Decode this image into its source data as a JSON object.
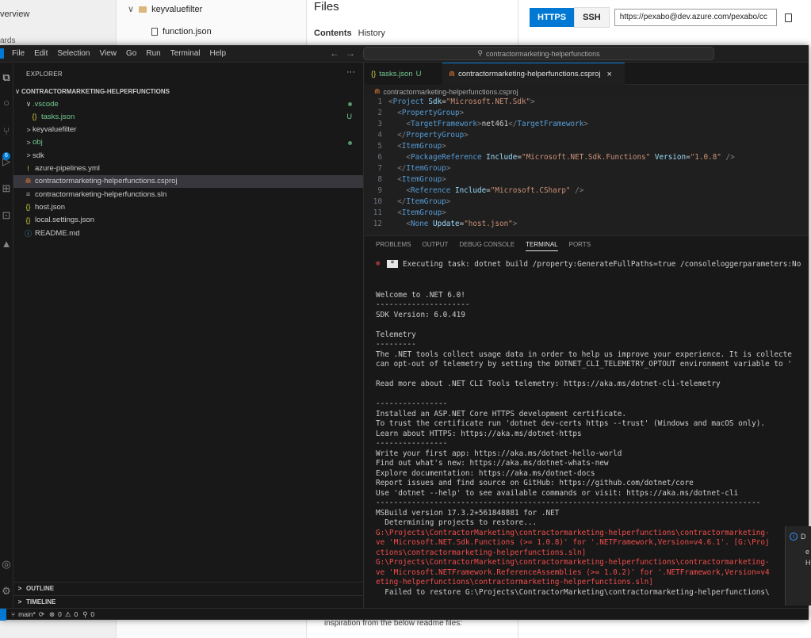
{
  "browser": {
    "left_nav": {
      "overview": "verview",
      "boards": "ards"
    },
    "tree": [
      {
        "label": "keyvaluefilter",
        "icon": "folder-icon"
      },
      {
        "label": "function.json",
        "icon": "file-icon"
      }
    ],
    "files_title": "Files",
    "tabs": [
      "Contents",
      "History"
    ],
    "bottom_text": "inspiration from the below readme files:",
    "clone": {
      "https": "HTTPS",
      "ssh": "SSH",
      "url": "https://pexabo@dev.azure.com/pexabo/cc"
    }
  },
  "vscode": {
    "menu": [
      "File",
      "Edit",
      "Selection",
      "View",
      "Go",
      "Run",
      "Terminal",
      "Help"
    ],
    "command_center": "contractormarketing-helperfunctions",
    "explorer": {
      "header": "EXPLORER",
      "root": "CONTRACTORMARKETING-HELPERFUNCTIONS",
      "items": [
        {
          "label": ".vscode",
          "chev": "∨",
          "icon": "",
          "status": "dot",
          "color": "green"
        },
        {
          "label": "tasks.json",
          "chev": "",
          "icon": "{}",
          "status": "U",
          "color": "green"
        },
        {
          "label": "keyvaluefilter",
          "chev": ">",
          "icon": "",
          "status": "",
          "color": ""
        },
        {
          "label": "obj",
          "chev": ">",
          "icon": "",
          "status": "dot",
          "color": "green"
        },
        {
          "label": "sdk",
          "chev": ">",
          "icon": "",
          "status": "",
          "color": ""
        },
        {
          "label": "azure-pipelines.yml",
          "chev": "",
          "icon": "!",
          "status": "",
          "color": ""
        },
        {
          "label": "contractormarketing-helperfunctions.csproj",
          "chev": "",
          "icon": "⋒",
          "status": "",
          "color": ""
        },
        {
          "label": "contractormarketing-helperfunctions.sln",
          "chev": "",
          "icon": "≡",
          "status": "",
          "color": ""
        },
        {
          "label": "host.json",
          "chev": "",
          "icon": "{}",
          "status": "",
          "color": ""
        },
        {
          "label": "local.settings.json",
          "chev": "",
          "icon": "{}",
          "status": "",
          "color": ""
        },
        {
          "label": "README.md",
          "chev": "",
          "icon": "ⓘ",
          "status": "",
          "color": ""
        }
      ],
      "outline": "OUTLINE",
      "timeline": "TIMELINE"
    },
    "tabs": [
      {
        "label": "tasks.json",
        "badge": "U"
      },
      {
        "label": "contractormarketing-helperfunctions.csproj",
        "close": "×"
      }
    ],
    "breadcrumb": "contractormarketing-helperfunctions.csproj",
    "code_lines": [
      {
        "n": "1",
        "html": "<span class='tg'>&lt;</span><span class='tn'>Project</span> <span class='at'>Sdk</span>=<span class='av'>\"Microsoft.NET.Sdk\"</span><span class='tg'>&gt;</span>"
      },
      {
        "n": "2",
        "html": "  <span class='tg'>&lt;</span><span class='tn'>PropertyGroup</span><span class='tg'>&gt;</span>"
      },
      {
        "n": "3",
        "html": "    <span class='tg'>&lt;</span><span class='tn'>TargetFramework</span><span class='tg'>&gt;</span>net461<span class='tg'>&lt;/</span><span class='tn'>TargetFramework</span><span class='tg'>&gt;</span>"
      },
      {
        "n": "4",
        "html": "  <span class='tg'>&lt;/</span><span class='tn'>PropertyGroup</span><span class='tg'>&gt;</span>"
      },
      {
        "n": "5",
        "html": "  <span class='tg'>&lt;</span><span class='tn'>ItemGroup</span><span class='tg'>&gt;</span>"
      },
      {
        "n": "6",
        "html": "    <span class='tg'>&lt;</span><span class='tn'>PackageReference</span> <span class='at'>Include</span>=<span class='av'>\"Microsoft.NET.Sdk.Functions\"</span> <span class='at'>Version</span>=<span class='av'>\"1.0.8\"</span> <span class='tg'>/&gt;</span>"
      },
      {
        "n": "7",
        "html": "  <span class='tg'>&lt;/</span><span class='tn'>ItemGroup</span><span class='tg'>&gt;</span>"
      },
      {
        "n": "8",
        "html": "  <span class='tg'>&lt;</span><span class='tn'>ItemGroup</span><span class='tg'>&gt;</span>"
      },
      {
        "n": "9",
        "html": "    <span class='tg'>&lt;</span><span class='tn'>Reference</span> <span class='at'>Include</span>=<span class='av'>\"Microsoft.CSharp\"</span> <span class='tg'>/&gt;</span>"
      },
      {
        "n": "10",
        "html": "  <span class='tg'>&lt;/</span><span class='tn'>ItemGroup</span><span class='tg'>&gt;</span>"
      },
      {
        "n": "11",
        "html": "  <span class='tg'>&lt;</span><span class='tn'>ItemGroup</span><span class='tg'>&gt;</span>"
      },
      {
        "n": "12",
        "html": "    <span class='tg'>&lt;</span><span class='tn'>None</span> <span class='at'>Update</span>=<span class='av'>\"host.json\"</span><span class='tg'>&gt;</span>"
      }
    ],
    "panel_tabs": [
      "PROBLEMS",
      "OUTPUT",
      "DEBUG CONSOLE",
      "TERMINAL",
      "PORTS"
    ],
    "exec_line": "Executing task: dotnet build /property:GenerateFullPaths=true /consoleloggerparameters:No",
    "terminal_lines": [
      {
        "t": "",
        "c": ""
      },
      {
        "t": "",
        "c": ""
      },
      {
        "t": "Welcome to .NET 6.0!",
        "c": ""
      },
      {
        "t": "---------------------",
        "c": ""
      },
      {
        "t": "SDK Version: 6.0.419",
        "c": ""
      },
      {
        "t": "",
        "c": ""
      },
      {
        "t": "Telemetry",
        "c": ""
      },
      {
        "t": "---------",
        "c": ""
      },
      {
        "t": "The .NET tools collect usage data in order to help us improve your experience. It is collecte",
        "c": ""
      },
      {
        "t": "can opt-out of telemetry by setting the DOTNET_CLI_TELEMETRY_OPTOUT environment variable to '",
        "c": ""
      },
      {
        "t": "",
        "c": ""
      },
      {
        "t": "Read more about .NET CLI Tools telemetry: https://aka.ms/dotnet-cli-telemetry",
        "c": ""
      },
      {
        "t": "",
        "c": ""
      },
      {
        "t": "----------------",
        "c": ""
      },
      {
        "t": "Installed an ASP.NET Core HTTPS development certificate.",
        "c": ""
      },
      {
        "t": "To trust the certificate run 'dotnet dev-certs https --trust' (Windows and macOS only).",
        "c": ""
      },
      {
        "t": "Learn about HTTPS: https://aka.ms/dotnet-https",
        "c": ""
      },
      {
        "t": "----------------",
        "c": ""
      },
      {
        "t": "Write your first app: https://aka.ms/dotnet-hello-world",
        "c": ""
      },
      {
        "t": "Find out what's new: https://aka.ms/dotnet-whats-new",
        "c": ""
      },
      {
        "t": "Explore documentation: https://aka.ms/dotnet-docs",
        "c": ""
      },
      {
        "t": "Report issues and find source on GitHub: https://github.com/dotnet/core",
        "c": ""
      },
      {
        "t": "Use 'dotnet --help' to see available commands or visit: https://aka.ms/dotnet-cli",
        "c": ""
      },
      {
        "t": "--------------------------------------------------------------------------------------",
        "c": ""
      },
      {
        "t": "MSBuild version 17.3.2+561848881 for .NET",
        "c": ""
      },
      {
        "t": "  Determining projects to restore...",
        "c": ""
      },
      {
        "t": "G:\\Projects\\ContractorMarketing\\contractormarketing-helperfunctions\\contractormarketing-",
        "c": "red"
      },
      {
        "t": "ve 'Microsoft.NET.Sdk.Functions (>= 1.0.8)' for '.NETFramework,Version=v4.6.1'. [G:\\Proj",
        "c": "red"
      },
      {
        "t": "ctions\\contractormarketing-helperfunctions.sln]",
        "c": "red"
      },
      {
        "t": "G:\\Projects\\ContractorMarketing\\contractormarketing-helperfunctions\\contractormarketing-",
        "c": "red"
      },
      {
        "t": "ve 'Microsoft.NETFramework.ReferenceAssemblies (>= 1.0.2)' for '.NETFramework,Version=v4",
        "c": "red"
      },
      {
        "t": "eting-helperfunctions\\contractormarketing-helperfunctions.sln]",
        "c": "red"
      },
      {
        "t": "  Failed to restore G:\\Projects\\ContractorMarketing\\contractormarketing-helperfunctions\\",
        "c": ""
      }
    ],
    "notification_fragments": [
      "D",
      "e",
      "H"
    ],
    "status": {
      "branch": "main*",
      "problems": "0",
      "warnings": "0",
      "ports": "0"
    },
    "colors": {
      "accent": "#0078d4",
      "editor_bg": "#1f1f1f",
      "sidebar_bg": "#181818",
      "error": "#f14c4c",
      "git_untracked": "#73c991"
    }
  }
}
